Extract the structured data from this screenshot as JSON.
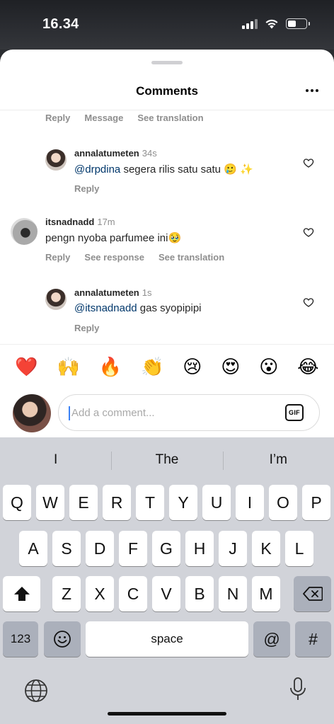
{
  "status_bar": {
    "time": "16.34",
    "signal": "signal-bars-icon",
    "wifi": "wifi-icon",
    "battery": "battery-icon"
  },
  "sheet": {
    "title": "Comments",
    "more": "more-icon"
  },
  "comments": {
    "top_meta": {
      "reply": "Reply",
      "message": "Message",
      "translation": "See translation"
    },
    "items": [
      {
        "username": "annalatumeten",
        "time": "34s",
        "mention": "@drpdina",
        "text": " segera rilis satu satu 🥲 ✨",
        "reply": "Reply"
      },
      {
        "username": "itsnadnadd",
        "time": "17m",
        "mention": "",
        "text": "pengn nyoba parfumee ini🥹",
        "reply": "Reply",
        "see_response": "See response",
        "translation": "See translation"
      },
      {
        "username": "annalatumeten",
        "time": "1s",
        "mention": "@itsnadnadd",
        "text": " gas syopipipi",
        "reply": "Reply"
      }
    ]
  },
  "emoji_bar": [
    "❤️",
    "🙌",
    "🔥",
    "👏",
    "😢",
    "😍",
    "😮",
    "😂"
  ],
  "input": {
    "placeholder": "Add a comment...",
    "gif": "GIF"
  },
  "keyboard": {
    "suggestions": [
      "I",
      "The",
      "I’m"
    ],
    "row1": [
      "Q",
      "W",
      "E",
      "R",
      "T",
      "Y",
      "U",
      "I",
      "O",
      "P"
    ],
    "row2": [
      "A",
      "S",
      "D",
      "F",
      "G",
      "H",
      "J",
      "K",
      "L"
    ],
    "row3": [
      "Z",
      "X",
      "C",
      "V",
      "B",
      "N",
      "M"
    ],
    "numbers": "123",
    "space": "space",
    "at": "@",
    "hash": "#"
  },
  "colors": {
    "mention": "#00376b",
    "secondary_text": "#8e8e8e",
    "keyboard_bg": "#d1d3d9"
  }
}
